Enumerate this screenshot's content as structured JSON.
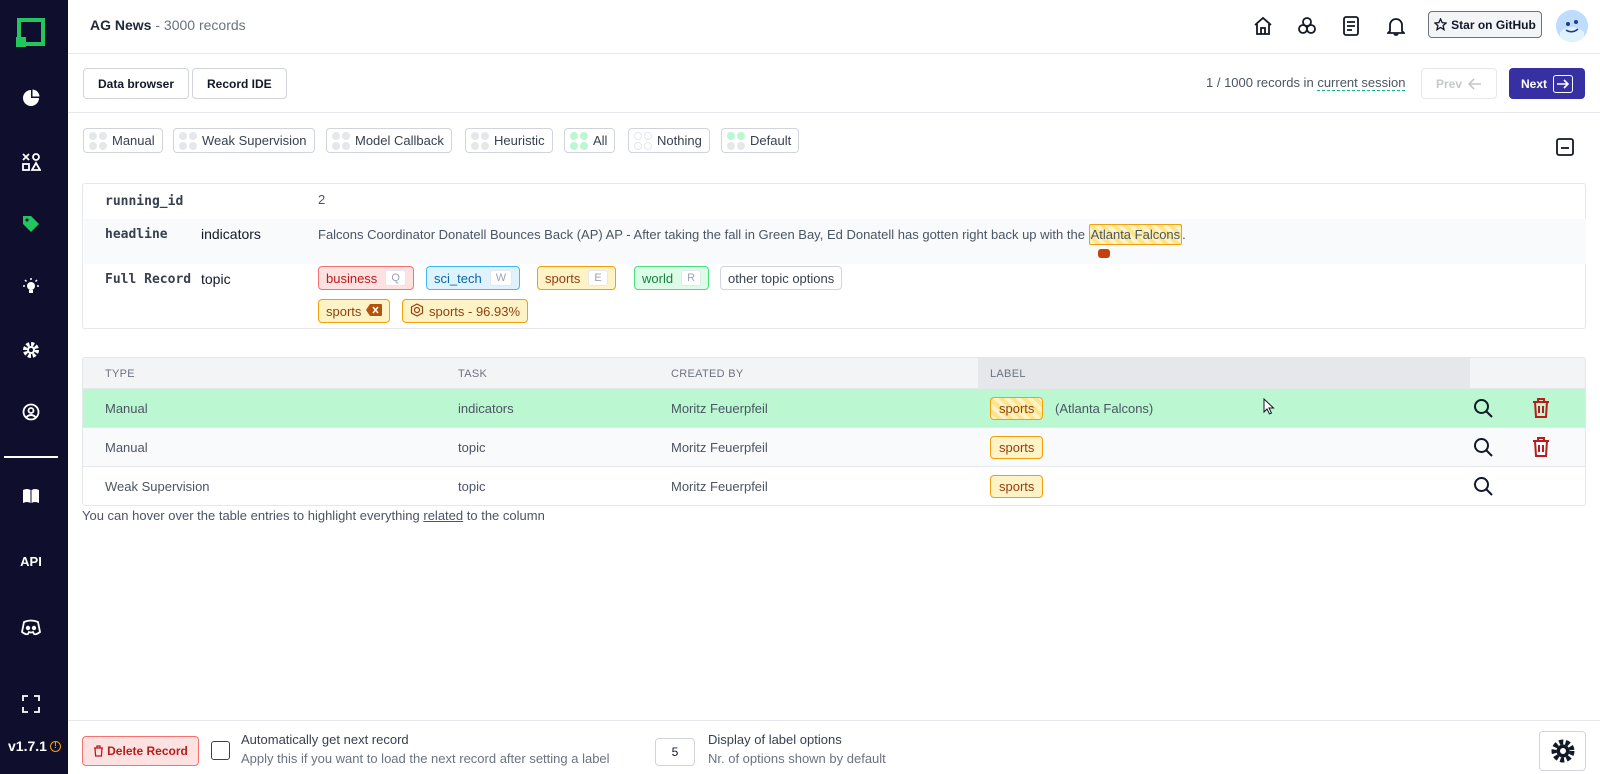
{
  "app": {
    "version": "v1.7.1"
  },
  "sidebar": {
    "icons": [
      "logo-icon",
      "overview-icon",
      "labeling-tasks-icon",
      "labeling-icon",
      "heuristics-icon",
      "settings-icon",
      "account-icon",
      "docs-icon",
      "api-icon",
      "discord-icon",
      "fullscreen-icon"
    ],
    "api_label": "API"
  },
  "header": {
    "project_name": "AG News",
    "separator": " - ",
    "record_count": "3000 records",
    "star_label": "Star on GitHub"
  },
  "nav": {
    "data_browser_label": "Data browser",
    "record_ide_label": "Record IDE",
    "session_prefix": "1 / 1000 records in",
    "session_link": "current session",
    "prev_label": "Prev",
    "next_label": "Next"
  },
  "filters": [
    {
      "label": "Manual",
      "dots": [
        "#e5e7eb",
        "#e5e7eb",
        "#e5e7eb",
        "#e5e7eb"
      ]
    },
    {
      "label": "Weak Supervision",
      "dots": [
        "#e5e7eb",
        "#e5e7eb",
        "#e5e7eb",
        "#e5e7eb"
      ]
    },
    {
      "label": "Model Callback",
      "dots": [
        "#e5e7eb",
        "#e5e7eb",
        "#e5e7eb",
        "#e5e7eb"
      ]
    },
    {
      "label": "Heuristic",
      "dots": [
        "#e5e7eb",
        "#e5e7eb",
        "#e5e7eb",
        "#e5e7eb"
      ]
    },
    {
      "label": "All",
      "dots": [
        "#bbf7d0",
        "#bbf7d0",
        "#bbf7d0",
        "#bbf7d0"
      ]
    },
    {
      "label": "Nothing",
      "dots": [
        "#ffffff",
        "#ffffff",
        "#ffffff",
        "#ffffff"
      ]
    },
    {
      "label": "Default",
      "dots": [
        "#bbf7d0",
        "#bbf7d0",
        "#e5e7eb",
        "#e5e7eb"
      ]
    }
  ],
  "record": {
    "running_id": {
      "name": "running_id",
      "value": "2"
    },
    "headline": {
      "name": "headline",
      "task": "indicators",
      "text_before": "Falcons Coordinator Donatell Bounces Back (AP) AP - After taking the fall in Green Bay, Ed Donatell has gotten right back up with the ",
      "highlight": "Atlanta Falcons",
      "text_after": "."
    },
    "full_record": {
      "name": "Full Record",
      "task": "topic",
      "labels": [
        {
          "label": "business",
          "key": "Q",
          "bg": "#fee2e2",
          "border": "#f87171",
          "color": "#b91c1c"
        },
        {
          "label": "sci_tech",
          "key": "W",
          "bg": "#e0f2fe",
          "border": "#38bdf8",
          "color": "#0369a1"
        },
        {
          "label": "sports",
          "key": "E",
          "bg": "#fef3c7",
          "border": "#f59e0b",
          "color": "#92400e"
        },
        {
          "label": "world",
          "key": "R",
          "bg": "#dcfce7",
          "border": "#4ade80",
          "color": "#15803d"
        }
      ],
      "other_options": "other topic options",
      "set_label": "sports",
      "prediction": "sports - 96.93%"
    }
  },
  "table": {
    "headers": {
      "type": "TYPE",
      "task": "TASK",
      "created_by": "CREATED BY",
      "label": "LABEL"
    },
    "rows": [
      {
        "type": "Manual",
        "task": "indicators",
        "created_by": "Moritz Feuerpfeil",
        "label": "sports",
        "span": "(Atlanta Falcons)",
        "deletable": true
      },
      {
        "type": "Manual",
        "task": "topic",
        "created_by": "Moritz Feuerpfeil",
        "label": "sports",
        "span": "",
        "deletable": true
      },
      {
        "type": "Weak Supervision",
        "task": "topic",
        "created_by": "Moritz Feuerpfeil",
        "label": "sports",
        "span": "",
        "deletable": false
      }
    ],
    "hint_before": "You can hover over the table entries to highlight everything",
    "hint_link": "related",
    "hint_after": "to the column"
  },
  "bottom": {
    "delete_label": "Delete Record",
    "auto_next_title": "Automatically get next record",
    "auto_next_sub": "Apply this if you want to load the next record after setting a label",
    "display_value": "5",
    "display_title": "Display of label options",
    "display_sub": "Nr. of options shown by default"
  },
  "colors": {
    "sidebar": "#0f0f2d",
    "accent": "#3730a3",
    "brand_green": "#22c55e",
    "row_highlight": "#bbf7d0"
  }
}
